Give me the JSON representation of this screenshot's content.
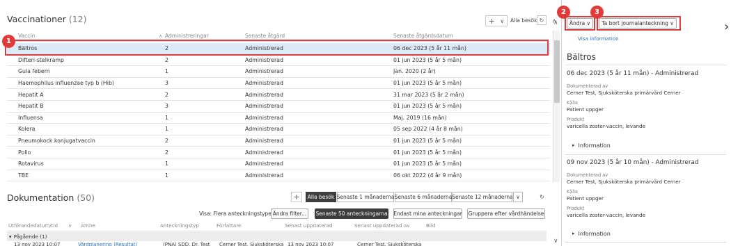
{
  "vaccinations": {
    "title": "Vaccinationer",
    "count": "(12)",
    "add_icon": "+",
    "chevron": "∨",
    "filter_label": "Alla besök",
    "refresh_icon": "↻",
    "collapse_icon": "∧",
    "columns": [
      "Vaccin",
      "Administreringar",
      "Senaste åtgärd",
      "Senaste åtgärdsdatum"
    ],
    "sort_icon": "∧",
    "rows": [
      {
        "vaccine": "Bältros",
        "count": "2",
        "action": "Administrerad",
        "date": "06 dec 2023 (5 år 11 mån)"
      },
      {
        "vaccine": "Difteri-stelkramp",
        "count": "2",
        "action": "Administrerad",
        "date": "01 jun 2023 (5 år 5 mån)"
      },
      {
        "vaccine": "Gula febern",
        "count": "1",
        "action": "Administrerad",
        "date": "Jan. 2020 (2 år)"
      },
      {
        "vaccine": "Haemophilus influenzae typ b (Hib)",
        "count": "3",
        "action": "Administrerad",
        "date": "01 jun 2023 (5 år 5 mån)"
      },
      {
        "vaccine": "Hepatit A",
        "count": "2",
        "action": "Administrerad",
        "date": "31 mar 2023 (5 år 2 mån)"
      },
      {
        "vaccine": "Hepatit B",
        "count": "3",
        "action": "Administrerad",
        "date": "01 jun 2023 (5 år 5 mån)"
      },
      {
        "vaccine": "Influensa",
        "count": "1",
        "action": "Administrerad",
        "date": "Maj. 2019 (16 mån)"
      },
      {
        "vaccine": "Kolera",
        "count": "1",
        "action": "Administrerad",
        "date": "05 sep 2022 (4 år 8 mån)"
      },
      {
        "vaccine": "Pneumokock konjugatvaccin",
        "count": "2",
        "action": "Administrerad",
        "date": "01 jun 2023 (5 år 5 mån)"
      },
      {
        "vaccine": "Polio",
        "count": "2",
        "action": "Administrerad",
        "date": "01 jun 2023 (5 år 5 mån)"
      },
      {
        "vaccine": "Rotavirus",
        "count": "1",
        "action": "Administrerad",
        "date": "01 jun 2023 (5 år 5 mån)"
      },
      {
        "vaccine": "TBE",
        "count": "1",
        "action": "Administrerad",
        "date": "06 okt 2022 (4 år 9 mån)"
      }
    ]
  },
  "documentation": {
    "title": "Dokumentation",
    "count": "(50)",
    "add_icon": "+",
    "tabs": [
      "Alla besök",
      "Senaste 1 månaderna",
      "Senaste 6 månaderna",
      "Senaste 12 månaderna"
    ],
    "tab_dropdown": "∨",
    "refresh_icon": "↻",
    "visa_label": "Visa: Flera anteckningstyper",
    "filter_button": "Ändra filter...",
    "buttons": [
      "Senaste 50 anteckningarna",
      "Endast mina anteckningar",
      "Gruppera efter vårdhändelse"
    ],
    "columns": [
      "Utförandedatum/tid",
      "Ämne",
      "Anteckningstyp",
      "Författare",
      "Senast uppdaterad",
      "Senast uppdaterad av",
      "Bild"
    ],
    "group_label": "Pågående (1)",
    "group_toggle": "▾",
    "partial_row": {
      "date": "13 nov 2023 10:07",
      "subject": "Vårdplanering (Resultat)",
      "type": "(PNA) SDD, Dr. Test",
      "author": "Cerner Test, Sjuksköterska",
      "updated": "13 nov 2023 10:07",
      "updated_by": "Cerner Test, Sjuksköterska"
    }
  },
  "detail_panel": {
    "andra_button": "Ändra ∨",
    "remove_button": "Ta bort journalanteckning ∨",
    "close_icon": "›",
    "up_icon": "∧",
    "down_icon": "∨",
    "visa_link": "Visa information",
    "title": "Bältros",
    "entries": [
      {
        "heading": "06 dec 2023 (5 år 11 mån) - Administrerad",
        "documented_label": "Dokumenterad av",
        "documented_value": "Cerner Test, Sjuksköterska primärvård Cerner",
        "source_label": "Källa",
        "source_value": "Patient uppger",
        "product_label": "Produkt",
        "product_value": "varicella zoster-vaccin, levande",
        "info_label": "Information",
        "info_toggle": "▸"
      },
      {
        "heading": "09 nov 2023 (5 år 10 mån) - Administrerad",
        "documented_label": "Dokumenterad av",
        "documented_value": "Cerner Test, Sjuksköterska primärvård Cerner",
        "source_label": "Källa",
        "source_value": "Patient uppger",
        "product_label": "Produkt",
        "product_value": "varicella zoster-vaccin, levande",
        "info_label": "Information",
        "info_toggle": "▸"
      }
    ]
  },
  "callouts": [
    "1",
    "2",
    "3"
  ],
  "colors": {
    "callout_red": "#e03a3a",
    "selected_row": "#dceaf7",
    "link_blue": "#2a6ebb",
    "dark_button": "#3c3c3c"
  }
}
